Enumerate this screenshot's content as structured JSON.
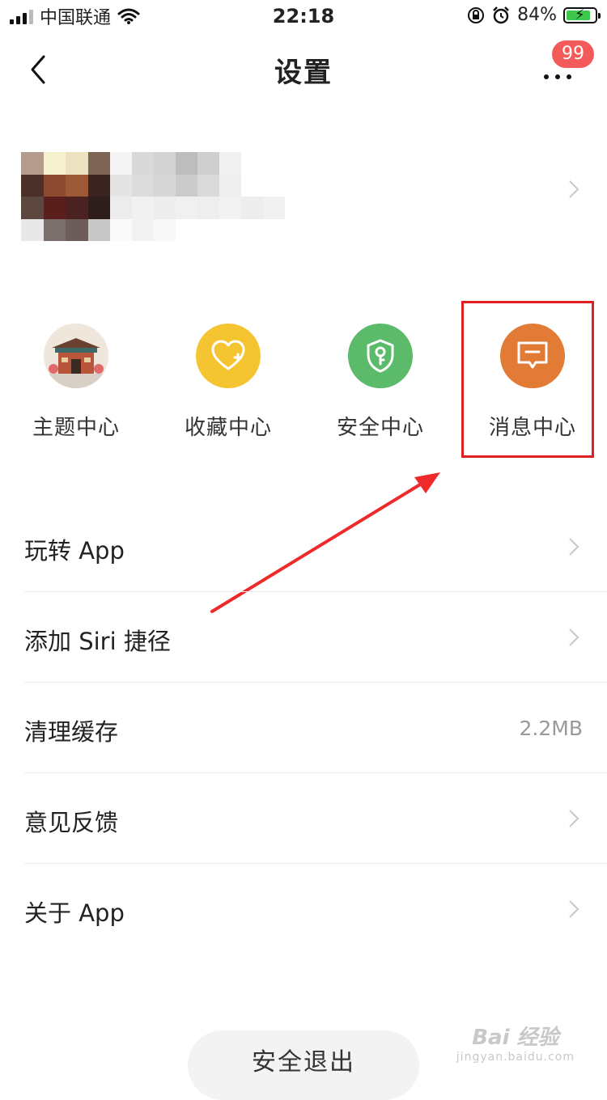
{
  "status_bar": {
    "carrier": "中国联通",
    "time": "22:18",
    "battery_percent": "84%",
    "battery_level": 0.84
  },
  "nav": {
    "title": "设置",
    "badge": "99"
  },
  "quick_actions": [
    {
      "label": "主题中心",
      "icon": "theme-icon"
    },
    {
      "label": "收藏中心",
      "icon": "heart-icon",
      "color": "#f5c431"
    },
    {
      "label": "安全中心",
      "icon": "shield-key-icon",
      "color": "#5bbb6a"
    },
    {
      "label": "消息中心",
      "icon": "message-icon",
      "color": "#e27b35"
    }
  ],
  "settings": [
    {
      "label": "玩转 App",
      "value": ""
    },
    {
      "label": "添加 Siri 捷径",
      "value": ""
    },
    {
      "label": "清理缓存",
      "value": "2.2MB"
    },
    {
      "label": "意见反馈",
      "value": ""
    },
    {
      "label": "关于 App",
      "value": ""
    }
  ],
  "logout_label": "安全退出",
  "watermark": {
    "main": "Bai 经验",
    "sub": "jingyan.baidu.com"
  },
  "colors": {
    "highlight": "#e21f1f",
    "badge": "#f35b5b"
  }
}
